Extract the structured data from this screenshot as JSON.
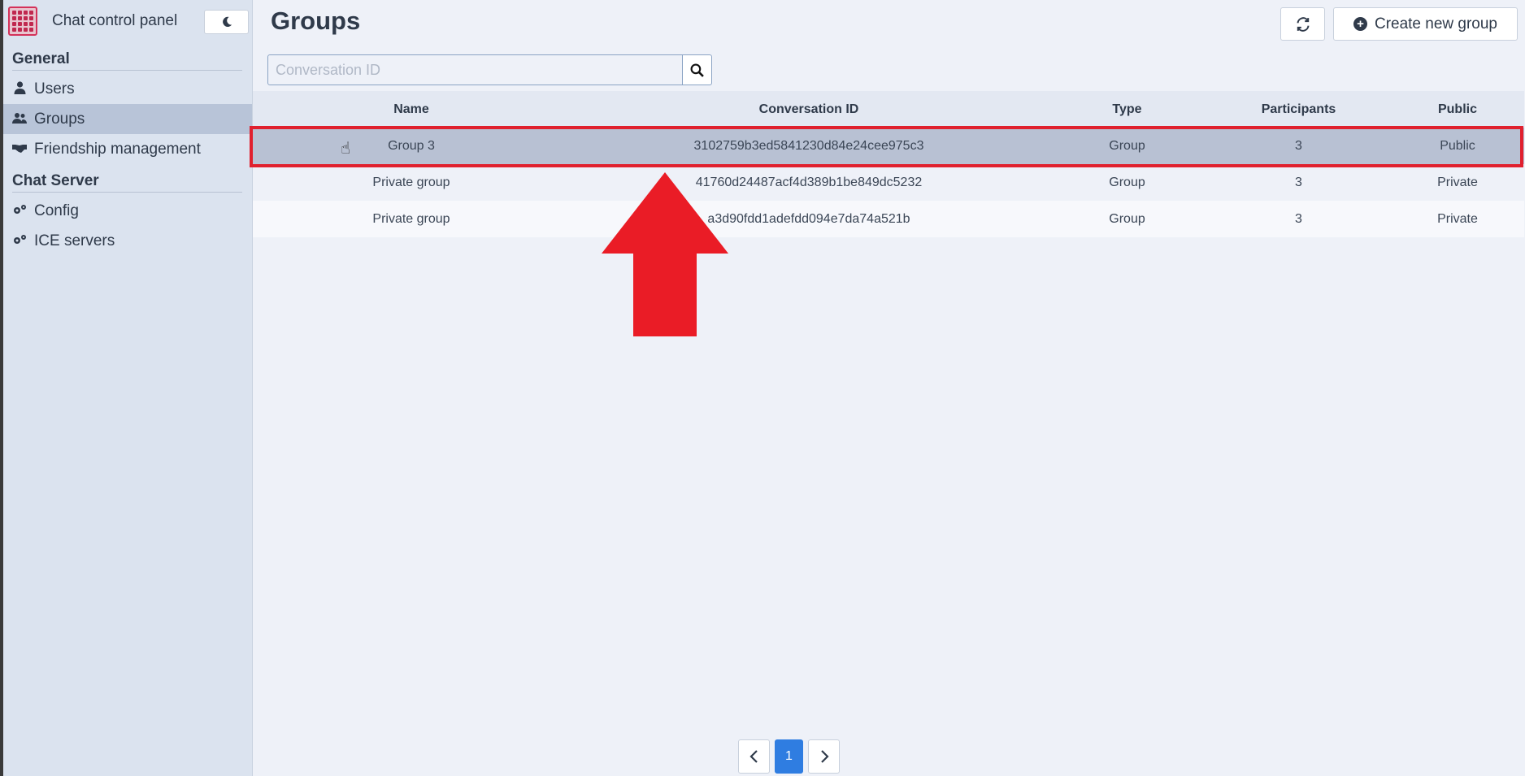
{
  "app": {
    "title": "Chat control panel",
    "theme_icon": "moon-icon"
  },
  "sidebar": {
    "sections": [
      {
        "title": "General",
        "items": [
          {
            "label": "Users",
            "icon": "user-icon"
          },
          {
            "label": "Groups",
            "icon": "users-icon",
            "active": true
          },
          {
            "label": "Friendship management",
            "icon": "handshake-icon"
          }
        ]
      },
      {
        "title": "Chat Server",
        "items": [
          {
            "label": "Config",
            "icon": "gears-icon"
          },
          {
            "label": "ICE servers",
            "icon": "gears-icon"
          }
        ]
      }
    ]
  },
  "main": {
    "title": "Groups",
    "create_label": "Create new group",
    "search": {
      "placeholder": "Conversation ID",
      "value": ""
    },
    "table": {
      "headers": {
        "name": "Name",
        "id": "Conversation ID",
        "type": "Type",
        "participants": "Participants",
        "public": "Public"
      },
      "rows": [
        {
          "name": "Group 3",
          "id": "3102759b3ed5841230d84e24cee975c3",
          "type": "Group",
          "participants": "3",
          "public": "Public",
          "selected": true
        },
        {
          "name": "Private group",
          "id": "41760d24487acf4d389b1be849dc5232",
          "type": "Group",
          "participants": "3",
          "public": "Private"
        },
        {
          "name": "Private group",
          "id": "a3d90fdd1adefdd094e7da74a521b",
          "type": "Group",
          "participants": "3",
          "public": "Private"
        }
      ]
    },
    "pagination": {
      "current": "1"
    }
  },
  "colors": {
    "accent": "#2f7de1",
    "highlight": "#e0202e",
    "sidebar": "#dbe3ef",
    "selected_row": "#b8c1d3"
  }
}
